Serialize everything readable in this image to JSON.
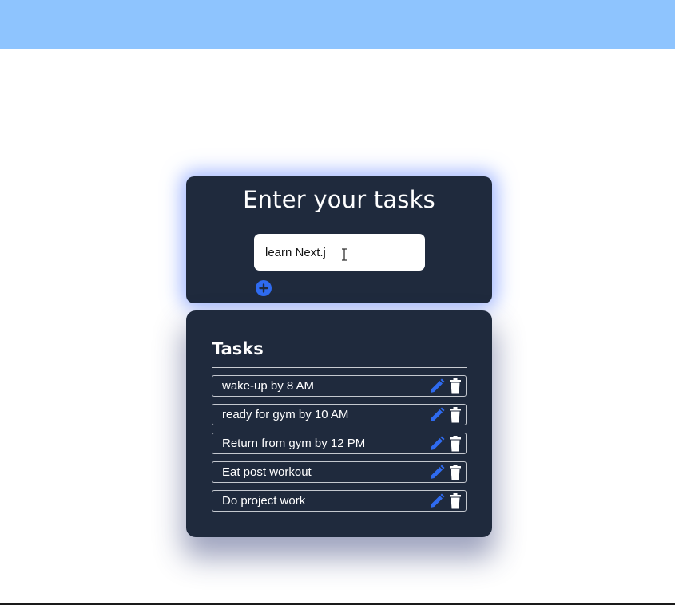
{
  "form": {
    "title": "Enter your tasks",
    "input_value": "learn Next.j",
    "add_icon": "plus-circle-icon"
  },
  "list": {
    "title": "Tasks",
    "tasks": [
      {
        "text": "wake-up by 8 AM"
      },
      {
        "text": "ready for gym by 10 AM"
      },
      {
        "text": "Return from gym by 12 PM"
      },
      {
        "text": "Eat post workout"
      },
      {
        "text": "Do project work"
      }
    ],
    "edit_icon": "pencil-icon",
    "delete_icon": "trash-icon"
  },
  "colors": {
    "top_bar": "#8ec4fe",
    "card_bg": "#1f2a3d",
    "accent_blue": "#2f6bf0"
  }
}
